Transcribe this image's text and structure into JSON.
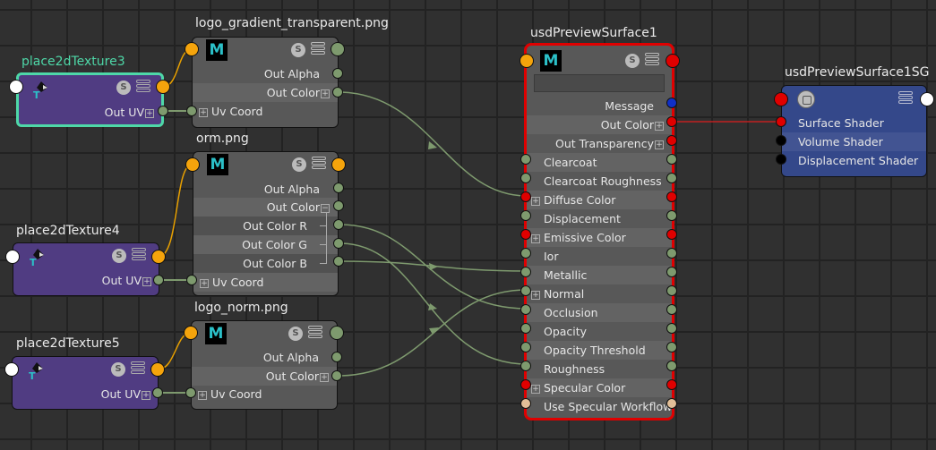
{
  "app": "Maya Hypershade Node Editor",
  "colors": {
    "background": "#303030",
    "grid_line": "#222222",
    "place2d_body": "#503c82",
    "file_body": "#585858",
    "sg_body": "#34488a",
    "selected_outline": "#4ed8a8",
    "shader_outline": "#e00000",
    "port_float": "#7e9a6e",
    "port_color": "#e00000",
    "port_message": "#1030c8",
    "port_bool": "#e2bf98",
    "port_orange": "#f5a40c",
    "wire_float": "#7e9a6e",
    "wire_color": "#c02020",
    "wire_orange": "#e8a000"
  },
  "nodes": {
    "place2d3": {
      "title": "place2dTexture3",
      "selected": true,
      "icons": [
        "place2d-texture-icon",
        "swatch-s-icon",
        "attribute-list-icon"
      ],
      "attrs": [
        {
          "label": "Out UV",
          "expand": "+"
        }
      ]
    },
    "place2d4": {
      "title": "place2dTexture4",
      "selected": false,
      "attrs": [
        {
          "label": "Out UV",
          "expand": "+"
        }
      ]
    },
    "place2d5": {
      "title": "place2dTexture5",
      "selected": false,
      "attrs": [
        {
          "label": "Out UV",
          "expand": "+"
        }
      ]
    },
    "file1": {
      "title": "logo_gradient_transparent.png",
      "icon_letter": "M",
      "s_label": "S",
      "attrs": [
        {
          "label": "Out Alpha"
        },
        {
          "label": "Out Color",
          "expand": "+"
        },
        {
          "label": "Uv Coord",
          "expand": "+"
        }
      ]
    },
    "file2": {
      "title": "orm.png",
      "icon_letter": "M",
      "s_label": "S",
      "attrs": [
        {
          "label": "Out Alpha"
        },
        {
          "label": "Out Color",
          "expand": "−"
        },
        {
          "label": "Out Color R"
        },
        {
          "label": "Out Color G"
        },
        {
          "label": "Out Color B"
        },
        {
          "label": "Uv Coord",
          "expand": "+"
        }
      ]
    },
    "file3": {
      "title": "logo_norm.png",
      "icon_letter": "M",
      "s_label": "S",
      "attrs": [
        {
          "label": "Out Alpha"
        },
        {
          "label": "Out Color",
          "expand": "+"
        },
        {
          "label": "Uv Coord",
          "expand": "+"
        }
      ]
    },
    "usd": {
      "title": "usdPreviewSurface1",
      "icon_letter": "M",
      "s_label": "S",
      "message_field": "",
      "outputs": [
        {
          "label": "Message"
        },
        {
          "label": "Out Color",
          "expand": "+"
        },
        {
          "label": "Out Transparency",
          "expand": "+"
        }
      ],
      "inputs": [
        {
          "label": "Clearcoat"
        },
        {
          "label": "Clearcoat Roughness"
        },
        {
          "label": "Diffuse Color",
          "expand": "+"
        },
        {
          "label": "Displacement"
        },
        {
          "label": "Emissive Color",
          "expand": "+"
        },
        {
          "label": "Ior"
        },
        {
          "label": "Metallic"
        },
        {
          "label": "Normal",
          "expand": "+"
        },
        {
          "label": "Occlusion"
        },
        {
          "label": "Opacity"
        },
        {
          "label": "Opacity Threshold"
        },
        {
          "label": "Roughness"
        },
        {
          "label": "Specular Color",
          "expand": "+"
        },
        {
          "label": "Use Specular Workflow"
        }
      ]
    },
    "sg": {
      "title": "usdPreviewSurface1SG",
      "attrs": [
        {
          "label": "Surface Shader"
        },
        {
          "label": "Volume Shader"
        },
        {
          "label": "Displacement Shader"
        }
      ]
    }
  },
  "connections": [
    {
      "from": "place2dTexture3.Out UV",
      "to": "logo_gradient_transparent.png.Uv Coord"
    },
    {
      "from": "place2dTexture4.Out UV",
      "to": "orm.png.Uv Coord"
    },
    {
      "from": "place2dTexture5.Out UV",
      "to": "logo_norm.png.Uv Coord"
    },
    {
      "from": "logo_gradient_transparent.png.Out Color",
      "to": "usdPreviewSurface1.Diffuse Color"
    },
    {
      "from": "orm.png.Out Color R",
      "to": "usdPreviewSurface1.Occlusion"
    },
    {
      "from": "orm.png.Out Color G",
      "to": "usdPreviewSurface1.Roughness"
    },
    {
      "from": "orm.png.Out Color B",
      "to": "usdPreviewSurface1.Metallic"
    },
    {
      "from": "logo_norm.png.Out Color",
      "to": "usdPreviewSurface1.Normal"
    },
    {
      "from": "usdPreviewSurface1.Out Color",
      "to": "usdPreviewSurface1SG.Surface Shader"
    }
  ]
}
